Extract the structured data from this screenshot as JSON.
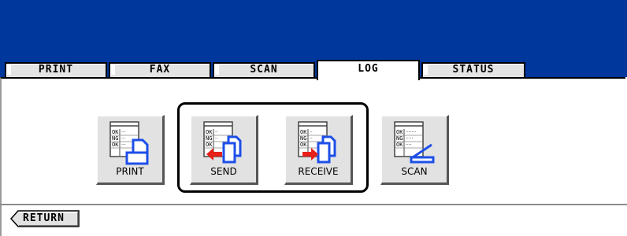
{
  "tabs": [
    {
      "label": "PRINT",
      "active": false
    },
    {
      "label": "FAX",
      "active": false
    },
    {
      "label": "SCAN",
      "active": false
    },
    {
      "label": "LOG",
      "active": true
    },
    {
      "label": "STATUS",
      "active": false
    }
  ],
  "log_buttons": {
    "print": {
      "label": "PRINT",
      "icon": "print-log-icon"
    },
    "send": {
      "label": "SEND",
      "icon": "send-log-icon"
    },
    "receive": {
      "label": "RECEIVE",
      "icon": "receive-log-icon"
    },
    "scan": {
      "label": "SCAN",
      "icon": "scan-log-icon"
    }
  },
  "icon_text": {
    "ok": "OK",
    "ng": "NG"
  },
  "return_button": {
    "label": "RETURN"
  },
  "colors": {
    "header": "#00379c",
    "button": "#e2e2e2",
    "accent_blue": "#1d4fe8",
    "arrow_red": "#e8201a"
  }
}
